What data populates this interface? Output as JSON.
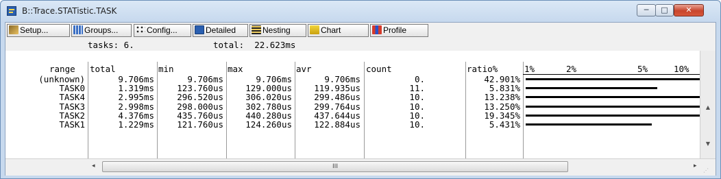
{
  "window": {
    "title": "B::Trace.STATistic.TASK",
    "controls": {
      "minimize": "─",
      "maximize": "□",
      "close": "✕"
    }
  },
  "toolbar": {
    "buttons": [
      {
        "label": "Setup...",
        "icon": "wrench-icon"
      },
      {
        "label": "Groups...",
        "icon": "groups-icon"
      },
      {
        "label": "Config...",
        "icon": "config-icon"
      },
      {
        "label": "Detailed",
        "icon": "detailed-icon"
      },
      {
        "label": "Nesting",
        "icon": "nesting-icon"
      },
      {
        "label": "Chart",
        "icon": "chart-icon"
      },
      {
        "label": "Profile",
        "icon": "profile-icon"
      }
    ]
  },
  "summary": {
    "tasks_label": "tasks: 6.",
    "total_label": "total:  22.623ms"
  },
  "table": {
    "columns": [
      "range",
      "total",
      "min",
      "max",
      "avr",
      "count",
      "ratio%",
      "1%",
      "2%",
      "5%",
      "10%"
    ],
    "rows": [
      {
        "range": "(unknown)",
        "total": "9.706ms",
        "min": "9.706ms",
        "max": "9.706ms",
        "avr": "9.706ms",
        "count": "0.",
        "ratio": "42.901%",
        "ratio_value": 42.901
      },
      {
        "range": "TASK0",
        "total": "1.319ms",
        "min": "123.760us",
        "max": "129.000us",
        "avr": "119.935us",
        "count": "11.",
        "ratio": "5.831%",
        "ratio_value": 5.831
      },
      {
        "range": "TASK4",
        "total": "2.995ms",
        "min": "296.520us",
        "max": "306.020us",
        "avr": "299.486us",
        "count": "10.",
        "ratio": "13.238%",
        "ratio_value": 13.238
      },
      {
        "range": "TASK3",
        "total": "2.998ms",
        "min": "298.000us",
        "max": "302.780us",
        "avr": "299.764us",
        "count": "10.",
        "ratio": "13.250%",
        "ratio_value": 13.25
      },
      {
        "range": "TASK2",
        "total": "4.376ms",
        "min": "435.760us",
        "max": "440.280us",
        "avr": "437.644us",
        "count": "10.",
        "ratio": "19.345%",
        "ratio_value": 19.345
      },
      {
        "range": "TASK1",
        "total": "1.229ms",
        "min": "121.760us",
        "max": "124.260us",
        "avr": "122.884us",
        "count": "10.",
        "ratio": "5.431%",
        "ratio_value": 5.431
      }
    ]
  },
  "scrollbar": {
    "thumb_grip": "III",
    "left_arrow": "◂",
    "right_arrow": "▸",
    "up_arrow": "▲",
    "down_arrow": "▼",
    "resize_grip": "⋰"
  }
}
